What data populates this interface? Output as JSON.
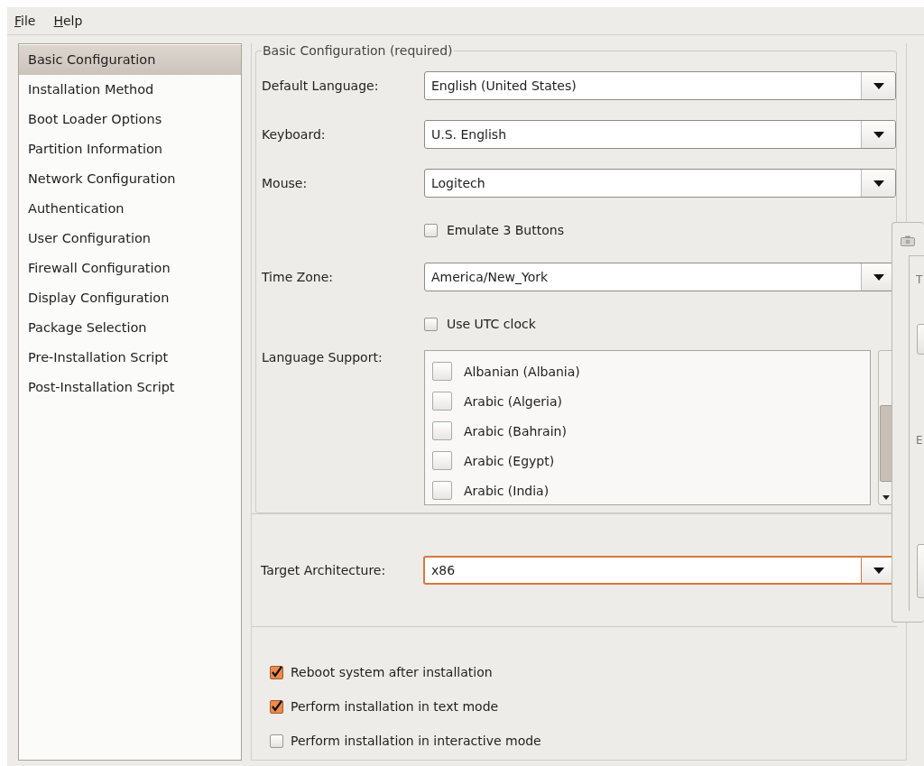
{
  "menu": [
    {
      "label": "File"
    },
    {
      "label": "Help"
    }
  ],
  "sidebar": {
    "items": [
      {
        "label": "Basic Configuration",
        "selected": true
      },
      {
        "label": "Installation Method",
        "selected": false
      },
      {
        "label": "Boot Loader Options",
        "selected": false
      },
      {
        "label": "Partition Information",
        "selected": false
      },
      {
        "label": "Network Configuration",
        "selected": false
      },
      {
        "label": "Authentication",
        "selected": false
      },
      {
        "label": "User Configuration",
        "selected": false
      },
      {
        "label": "Firewall Configuration",
        "selected": false
      },
      {
        "label": "Display Configuration",
        "selected": false
      },
      {
        "label": "Package Selection",
        "selected": false
      },
      {
        "label": "Pre-Installation Script",
        "selected": false
      },
      {
        "label": "Post-Installation Script",
        "selected": false
      }
    ]
  },
  "basic": {
    "title": "Basic Configuration (required)",
    "fields": [
      {
        "kind": "combo",
        "label": "Default Language:",
        "value": "English (United States)",
        "focused": false
      },
      {
        "kind": "combo",
        "label": "Keyboard:",
        "value": "U.S. English",
        "focused": false
      },
      {
        "kind": "combo",
        "label": "Mouse:",
        "value": "Logitech",
        "focused": false
      },
      {
        "kind": "check",
        "label": "Emulate 3 Buttons",
        "checked": false
      },
      {
        "kind": "combo",
        "label": "Time Zone:",
        "value": "America/New_York",
        "focused": false
      },
      {
        "kind": "check",
        "label": "Use UTC clock",
        "checked": false
      },
      {
        "kind": "list",
        "label": "Language Support:",
        "items": [
          {
            "label": "Albanian (Albania)",
            "checked": false
          },
          {
            "label": "Arabic (Algeria)",
            "checked": false
          },
          {
            "label": "Arabic (Bahrain)",
            "checked": false
          },
          {
            "label": "Arabic (Egypt)",
            "checked": false
          },
          {
            "label": "Arabic (India)",
            "checked": false
          }
        ]
      }
    ]
  },
  "target": {
    "kind": "combo",
    "label": "Target Architecture:",
    "value": "x86",
    "focused": true
  },
  "options": [
    {
      "label": "Reboot system after installation",
      "checked": true
    },
    {
      "label": "Perform installation in text mode",
      "checked": true
    },
    {
      "label": "Perform installation in interactive mode",
      "checked": false
    }
  ],
  "side_window": {
    "texts": [
      "T",
      "E"
    ]
  }
}
